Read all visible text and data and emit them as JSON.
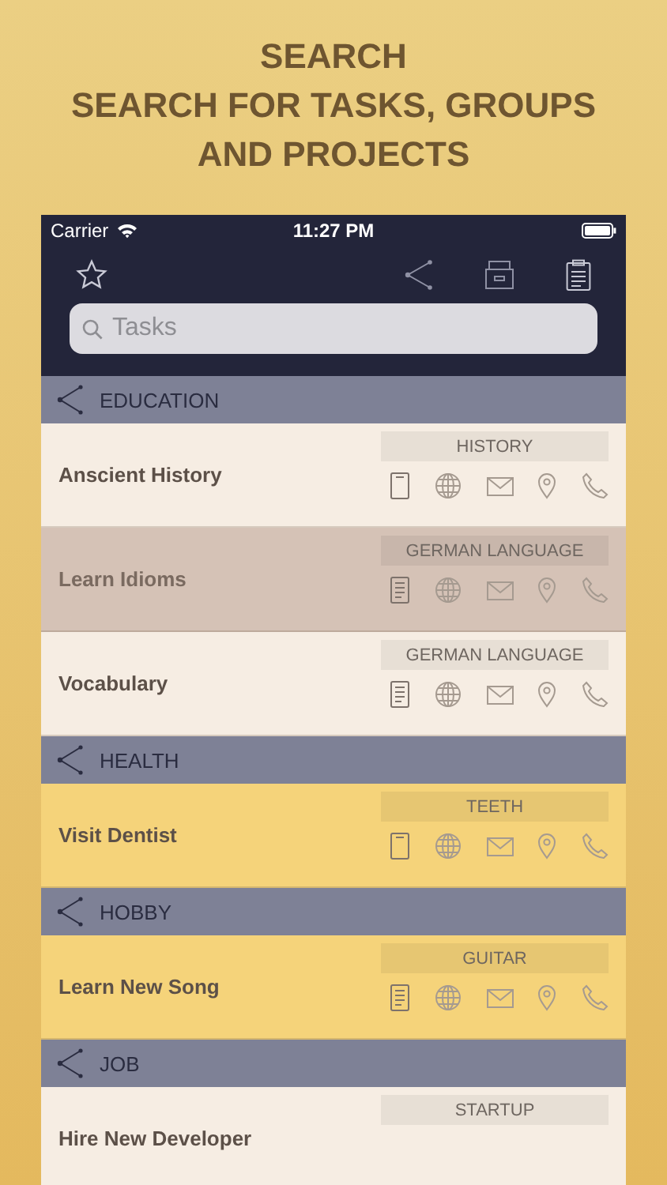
{
  "headline": [
    "SEARCH",
    "SEARCH FOR TASKS, GROUPS",
    "AND PROJECTS"
  ],
  "status_bar": {
    "carrier": "Carrier",
    "time": "11:27 PM"
  },
  "search": {
    "placeholder": "Tasks"
  },
  "groups": [
    {
      "title": "EDUCATION",
      "tasks": [
        {
          "title": "Anscient History",
          "tag": "HISTORY",
          "kind": "device",
          "color": "#f6ede3",
          "selected": false
        },
        {
          "title": "Learn Idioms",
          "tag": "GERMAN LANGUAGE",
          "kind": "note",
          "color": "#d5c2b6",
          "selected": true
        },
        {
          "title": "Vocabulary",
          "tag": "GERMAN LANGUAGE",
          "kind": "note",
          "color": "#f6ede3",
          "selected": false
        }
      ]
    },
    {
      "title": "HEALTH",
      "tasks": [
        {
          "title": "Visit Dentist",
          "tag": "TEETH",
          "kind": "device",
          "color": "#f5d37a",
          "selected": false
        }
      ]
    },
    {
      "title": "HOBBY",
      "tasks": [
        {
          "title": "Learn New Song",
          "tag": "GUITAR",
          "kind": "note",
          "color": "#f5d37a",
          "selected": false
        }
      ]
    },
    {
      "title": "JOB",
      "tasks": [
        {
          "title": "Hire New Developer",
          "tag": "STARTUP",
          "kind": "none",
          "color": "#f6ede3",
          "selected": false
        }
      ]
    }
  ]
}
